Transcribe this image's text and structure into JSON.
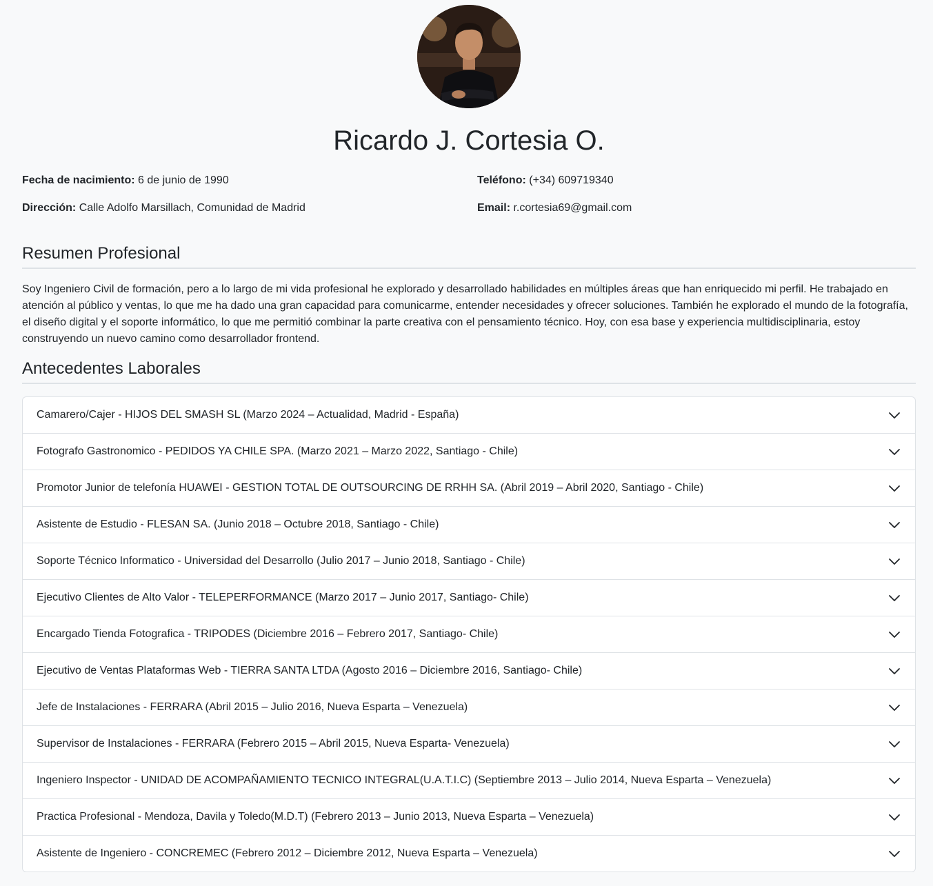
{
  "profile": {
    "name": "Ricardo J. Cortesia O.",
    "avatar_alt": "avatar"
  },
  "info": {
    "birth_label": "Fecha de nacimiento:",
    "birth_value": "6 de junio de 1990",
    "phone_label": "Teléfono:",
    "phone_value": "(+34) 609719340",
    "address_label": "Dirección:",
    "address_value": "Calle Adolfo Marsillach, Comunidad de Madrid",
    "email_label": "Email:",
    "email_value": "r.cortesia69@gmail.com"
  },
  "summary": {
    "title": "Resumen Profesional",
    "text": "Soy Ingeniero Civil de formación, pero a lo largo de mi vida profesional he explorado y desarrollado habilidades en múltiples áreas que han enriquecido mi perfil. He trabajado en atención al público y ventas, lo que me ha dado una gran capacidad para comunicarme, entender necesidades y ofrecer soluciones. También he explorado el mundo de la fotografía, el diseño digital y el soporte informático, lo que me permitió combinar la parte creativa con el pensamiento técnico. Hoy, con esa base y experiencia multidisciplinaria, estoy construyendo un nuevo camino como desarrollador frontend."
  },
  "work": {
    "title": "Antecedentes Laborales",
    "items": [
      "Camarero/Cajer - HIJOS DEL SMASH SL (Marzo 2024 – Actualidad, Madrid - España)",
      "Fotografo Gastronomico - PEDIDOS YA CHILE SPA. (Marzo 2021 – Marzo 2022, Santiago - Chile)",
      "Promotor Junior de telefonía HUAWEI - GESTION TOTAL DE OUTSOURCING DE RRHH SA. (Abril 2019 – Abril 2020, Santiago - Chile)",
      "Asistente de Estudio - FLESAN SA. (Junio 2018 – Octubre 2018, Santiago - Chile)",
      "Soporte Técnico Informatico - Universidad del Desarrollo (Julio 2017 – Junio 2018, Santiago - Chile)",
      "Ejecutivo Clientes de Alto Valor - TELEPERFORMANCE (Marzo 2017 – Junio 2017, Santiago- Chile)",
      "Encargado Tienda Fotografica - TRIPODES (Diciembre 2016 – Febrero 2017, Santiago- Chile)",
      "Ejecutivo de Ventas Plataformas Web - TIERRA SANTA LTDA (Agosto 2016 – Diciembre 2016, Santiago- Chile)",
      "Jefe de Instalaciones - FERRARA (Abril 2015 – Julio 2016, Nueva Esparta – Venezuela)",
      "Supervisor de Instalaciones - FERRARA (Febrero 2015 – Abril 2015, Nueva Esparta- Venezuela)",
      "Ingeniero Inspector - UNIDAD DE ACOMPAÑAMIENTO TECNICO INTEGRAL(U.A.T.I.C) (Septiembre 2013 – Julio 2014, Nueva Esparta – Venezuela)",
      "Practica Profesional - Mendoza, Davila y Toledo(M.D.T) (Febrero 2013 – Junio 2013, Nueva Esparta – Venezuela)",
      "Asistente de Ingeniero - CONCREMEC (Febrero 2012 – Diciembre 2012, Nueva Esparta – Venezuela)"
    ]
  }
}
